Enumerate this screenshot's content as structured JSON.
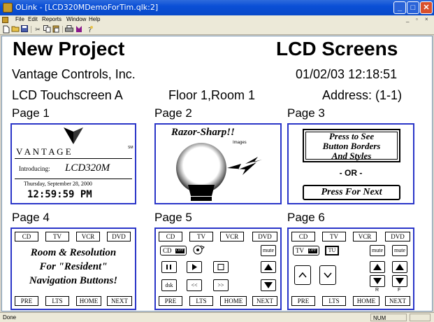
{
  "window": {
    "title": "OLink - [LCD320MDemoForTim.qlk:2]",
    "controls": [
      "_",
      "□",
      "✕"
    ]
  },
  "menu": {
    "items": [
      "File",
      "Edit",
      "Reports",
      "Window",
      "Help"
    ],
    "mdi_controls": [
      "_",
      "▫",
      "×"
    ]
  },
  "toolbar": {
    "icons": [
      "new-icon",
      "open-icon",
      "save-icon",
      "cut-icon",
      "copy-icon",
      "paste-icon",
      "print-icon",
      "tool-icon",
      "help-icon"
    ]
  },
  "header": {
    "project": "New Project",
    "section": "LCD Screens",
    "company": "Vantage Controls, Inc.",
    "datetime": "01/02/03 12:18:51",
    "device": "LCD Touchscreen A",
    "location": "Floor 1,Room 1",
    "address": "Address: (1-1)"
  },
  "pages": [
    {
      "label": "Page 1",
      "brand": "V A N T A G E",
      "brand_mark": "SM",
      "intro_label": "Introducing:",
      "model": "LCD320M",
      "date": "Thursday, September 28, 2000",
      "time": "12:59:59 PM"
    },
    {
      "label": "Page 2",
      "heading": "Razor-Sharp!!",
      "sub": "Images"
    },
    {
      "label": "Page 3",
      "top_button": [
        "Press to See",
        "Button Borders",
        "And Styles"
      ],
      "or": "- OR -",
      "bottom_button": "Press For Next"
    },
    {
      "label": "Page 4",
      "top_buttons": [
        "CD",
        "TV",
        "VCR",
        "DVD"
      ],
      "body": [
        "Room & Resolution",
        "For \"Resident\"",
        "Navigation Buttons!"
      ],
      "bottom_buttons": [
        "PRE",
        "LTS",
        "HOME",
        "NEXT"
      ]
    },
    {
      "label": "Page 5",
      "top_buttons": [
        "CD",
        "TV",
        "VCR",
        "DVD"
      ],
      "cd_label": "CD",
      "off_label": "OFF",
      "mute": "mute",
      "transport": [
        "||",
        "▶",
        "□"
      ],
      "disk": "dsk",
      "rew": "<<",
      "ffw": ">>",
      "bottom_buttons": [
        "PRE",
        "LTS",
        "HOME",
        "NEXT"
      ]
    },
    {
      "label": "Page 6",
      "top_buttons": [
        "CD",
        "TV",
        "VCR",
        "DVD"
      ],
      "tv_label": "TV",
      "off_label": "OFF",
      "tu_label": "TU",
      "mute": "mute",
      "r_label": "R",
      "f_label": "F",
      "bottom_buttons": [
        "PRE",
        "LTS",
        "HOME",
        "NEXT"
      ]
    }
  ],
  "status": {
    "left": "Done",
    "num": "NUM"
  },
  "colors": {
    "panel_border": "#2a35c8",
    "titlebar": "#0a4fd6"
  }
}
